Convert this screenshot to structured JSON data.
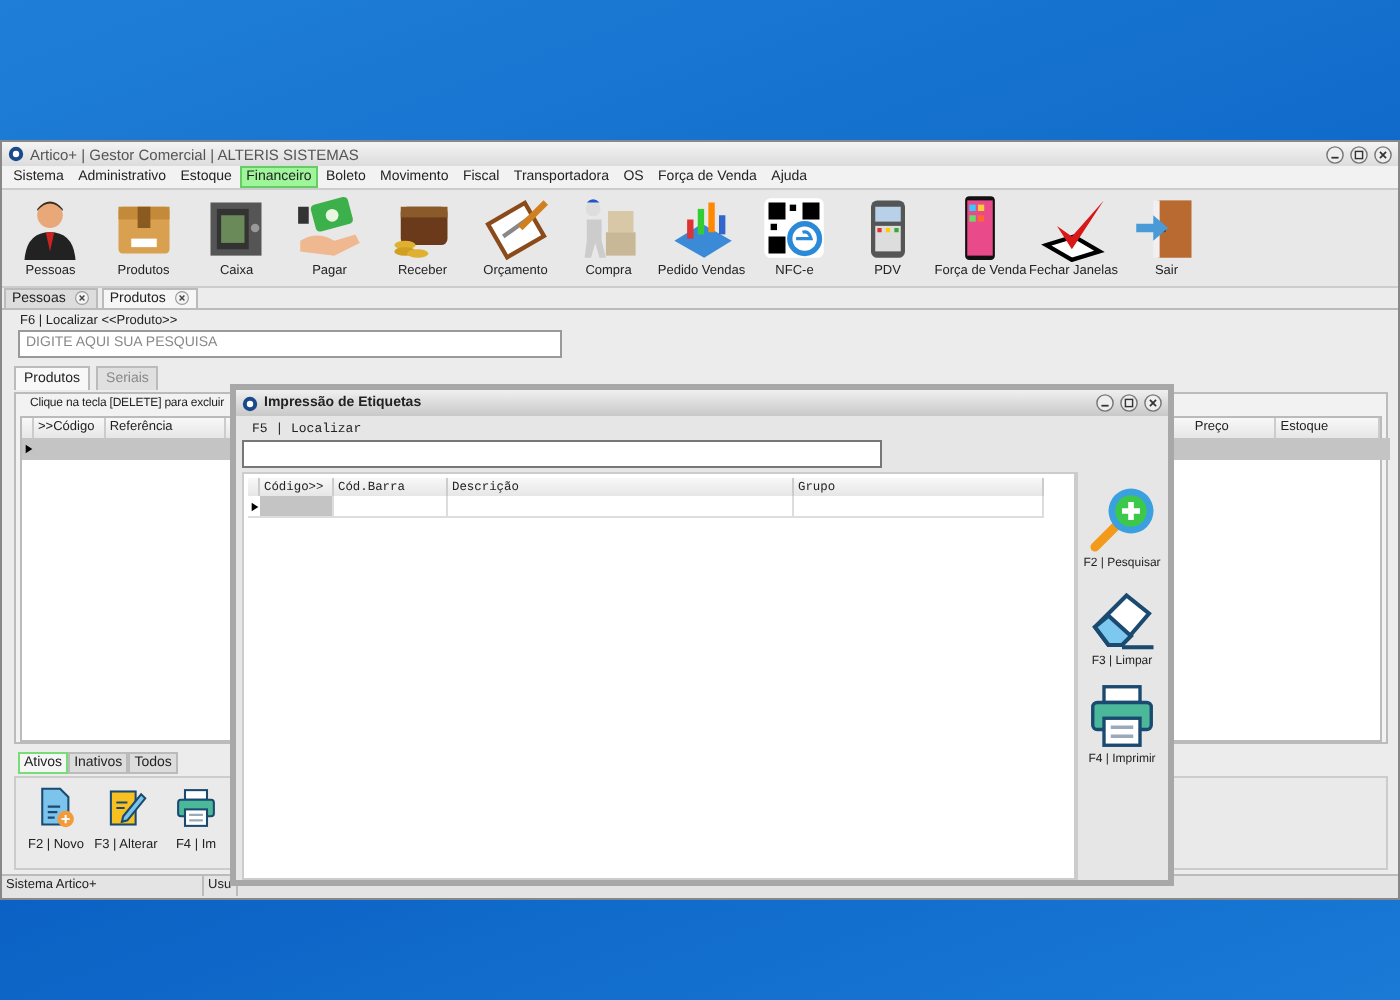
{
  "window": {
    "title": "Artico+ | Gestor Comercial | ALTERIS SISTEMAS"
  },
  "menu": [
    {
      "label": "Sistema",
      "selected": false
    },
    {
      "label": "Administrativo",
      "selected": false
    },
    {
      "label": "Estoque",
      "selected": false
    },
    {
      "label": "Financeiro",
      "selected": true
    },
    {
      "label": "Boleto",
      "selected": false
    },
    {
      "label": "Movimento",
      "selected": false
    },
    {
      "label": "Fiscal",
      "selected": false
    },
    {
      "label": "Transportadora",
      "selected": false
    },
    {
      "label": "OS",
      "selected": false
    },
    {
      "label": "Força de Venda",
      "selected": false
    },
    {
      "label": "Ajuda",
      "selected": false
    }
  ],
  "toolbar": [
    "Pessoas",
    "Produtos",
    "Caixa",
    "Pagar",
    "Receber",
    "Orçamento",
    "Compra",
    "Pedido Vendas",
    "NFC-e",
    "PDV",
    "Força de Venda",
    "Fechar Janelas",
    "Sair"
  ],
  "doc_tabs": [
    {
      "label": "Pessoas",
      "selected": false
    },
    {
      "label": "Produtos",
      "selected": true
    }
  ],
  "search": {
    "label": "F6 | Localizar <<Produto>>",
    "placeholder": "DIGITE AQUI SUA PESQUISA"
  },
  "sub_tabs": [
    {
      "label": "Produtos",
      "selected": true
    },
    {
      "label": "Seriais",
      "selected": false
    }
  ],
  "hint": "Clique na tecla [DELETE] para excluir",
  "table": {
    "columns_left": [
      ">>Código",
      "Referência"
    ],
    "columns_right": [
      "Preço",
      "Estoque"
    ]
  },
  "filter_tabs": [
    {
      "label": "Ativos",
      "selected": true
    },
    {
      "label": "Inativos",
      "selected": false
    },
    {
      "label": "Todos",
      "selected": false
    }
  ],
  "actions": [
    "F2 | Novo",
    "F3 | Alterar",
    "F4 | Im"
  ],
  "status_bar": [
    "Sistema Artico+",
    "Usu"
  ],
  "dialog": {
    "title": "Impressão de Etiquetas",
    "search_label": "F5 | Localizar",
    "columns": [
      "Código>>",
      "Cód.Barra",
      "Descrição",
      "Grupo"
    ],
    "actions": [
      "F2 | Pesquisar",
      "F3 | Limpar",
      "F4 | Imprimir"
    ]
  }
}
